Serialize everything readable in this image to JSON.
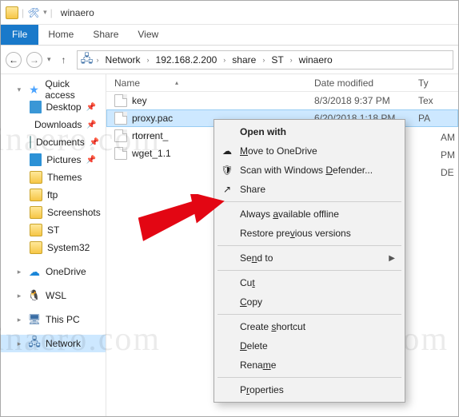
{
  "window": {
    "title": "winaero"
  },
  "ribbon": {
    "file": "File",
    "tabs": [
      "Home",
      "Share",
      "View"
    ]
  },
  "breadcrumb": [
    "Network",
    "192.168.2.200",
    "share",
    "ST",
    "winaero"
  ],
  "nav": {
    "quick_access": {
      "label": "Quick access",
      "children": [
        {
          "label": "Desktop",
          "pinned": true,
          "kind": "desktop"
        },
        {
          "label": "Downloads",
          "pinned": true,
          "kind": "downloads"
        },
        {
          "label": "Documents",
          "pinned": true,
          "kind": "documents"
        },
        {
          "label": "Pictures",
          "pinned": true,
          "kind": "pictures"
        },
        {
          "label": "Themes",
          "pinned": false,
          "kind": "folder"
        },
        {
          "label": "ftp",
          "pinned": false,
          "kind": "folder"
        },
        {
          "label": "Screenshots",
          "pinned": false,
          "kind": "folder"
        },
        {
          "label": "ST",
          "pinned": false,
          "kind": "folder"
        },
        {
          "label": "System32",
          "pinned": false,
          "kind": "folder"
        }
      ]
    },
    "roots": [
      {
        "label": "OneDrive",
        "kind": "onedrive"
      },
      {
        "label": "WSL",
        "kind": "wsl"
      },
      {
        "label": "This PC",
        "kind": "pc"
      },
      {
        "label": "Network",
        "kind": "network",
        "selected": true
      }
    ]
  },
  "columns": {
    "name": "Name",
    "date": "Date modified",
    "type": "Ty"
  },
  "files": [
    {
      "name": "key",
      "date": "8/3/2018 9:37 PM",
      "type": "Tex",
      "selected": false
    },
    {
      "name": "proxy.pac",
      "date": "6/20/2018 1:18 PM",
      "type": "PA",
      "selected": true
    },
    {
      "name": "rtorrent_",
      "date": "",
      "type": "",
      "selected": false
    },
    {
      "name": "wget_1.1",
      "date": "",
      "type": "",
      "selected": false
    }
  ],
  "files_cropped_meta": [
    {
      "type_suffix": "AM"
    },
    {
      "type_suffix": "PM"
    },
    {
      "type_suffix": "DE"
    }
  ],
  "context_menu": {
    "groups": [
      [
        {
          "label_pre": "",
          "accel": "",
          "label_post": "Open with",
          "bold": true,
          "icon": ""
        },
        {
          "label_pre": "",
          "accel": "M",
          "label_post": "ove to OneDrive",
          "icon": "cloud"
        },
        {
          "label_pre": "Scan with Windows ",
          "accel": "D",
          "label_post": "efender...",
          "icon": "shield"
        },
        {
          "label_pre": "",
          "accel": "",
          "label_post": "Share",
          "icon": "share"
        }
      ],
      [
        {
          "label_pre": "Always ",
          "accel": "a",
          "label_post": "vailable offline",
          "icon": ""
        },
        {
          "label_pre": "Restore pre",
          "accel": "v",
          "label_post": "ious versions",
          "icon": ""
        }
      ],
      [
        {
          "label_pre": "Se",
          "accel": "n",
          "label_post": "d to",
          "submenu": true
        }
      ],
      [
        {
          "label_pre": "Cu",
          "accel": "t",
          "label_post": ""
        },
        {
          "label_pre": "",
          "accel": "C",
          "label_post": "opy"
        }
      ],
      [
        {
          "label_pre": "Create ",
          "accel": "s",
          "label_post": "hortcut"
        },
        {
          "label_pre": "",
          "accel": "D",
          "label_post": "elete"
        },
        {
          "label_pre": "Rena",
          "accel": "m",
          "label_post": "e"
        }
      ],
      [
        {
          "label_pre": "P",
          "accel": "r",
          "label_post": "operties"
        }
      ]
    ]
  },
  "watermark": "winaero.com"
}
